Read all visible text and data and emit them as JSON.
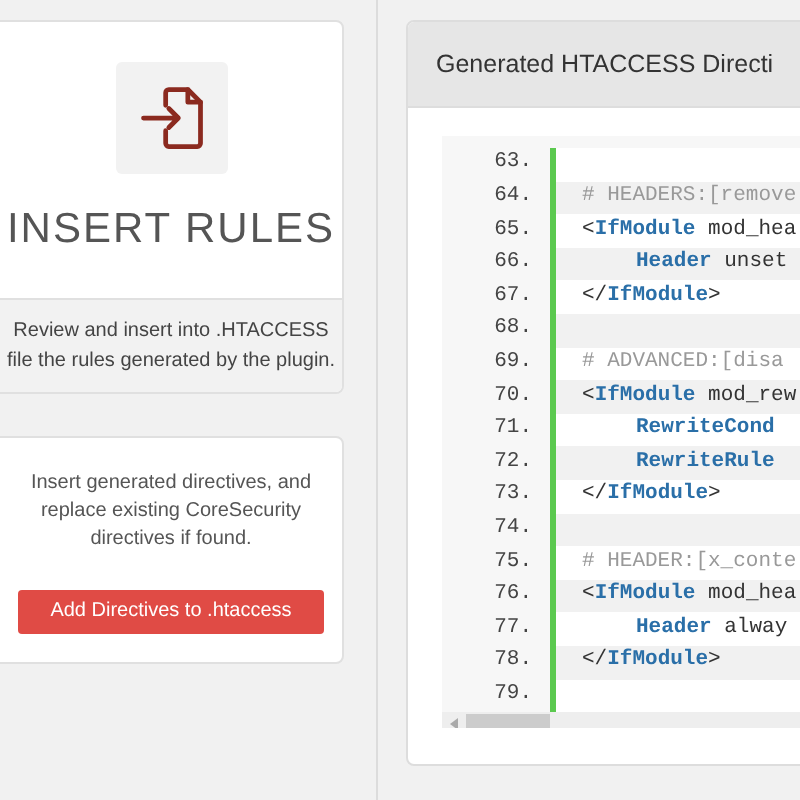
{
  "insert_card": {
    "title": "INSERT RULES",
    "description": "Review and insert into .HTACCESS file the rules generated by the plugin."
  },
  "action_card": {
    "text": "Insert generated directives, and replace existing CoreSecurity directives if found.",
    "button": "Add Directives to .htaccess"
  },
  "code_panel": {
    "title": "Generated HTACCESS Directi",
    "lines": [
      {
        "number": "63."
      },
      {
        "number": "64.",
        "indented": false,
        "tokens": [
          {
            "kind": "comment",
            "text": "# HEADERS:[remove"
          }
        ]
      },
      {
        "number": "65.",
        "indented": false,
        "tokens": [
          {
            "kind": "plain",
            "text": "<"
          },
          {
            "kind": "keyword",
            "text": "IfModule"
          },
          {
            "kind": "plain",
            "text": " mod_hea"
          }
        ]
      },
      {
        "number": "66.",
        "indented": true,
        "tokens": [
          {
            "kind": "keyword",
            "text": "Header"
          },
          {
            "kind": "plain",
            "text": " unset"
          }
        ]
      },
      {
        "number": "67.",
        "indented": false,
        "tokens": [
          {
            "kind": "plain",
            "text": "</"
          },
          {
            "kind": "keyword",
            "text": "IfModule"
          },
          {
            "kind": "plain",
            "text": ">"
          }
        ]
      },
      {
        "number": "68."
      },
      {
        "number": "69.",
        "indented": false,
        "tokens": [
          {
            "kind": "comment",
            "text": "# ADVANCED:[disa"
          }
        ]
      },
      {
        "number": "70.",
        "indented": false,
        "tokens": [
          {
            "kind": "plain",
            "text": "<"
          },
          {
            "kind": "keyword",
            "text": "IfModule"
          },
          {
            "kind": "plain",
            "text": " mod_rew"
          }
        ]
      },
      {
        "number": "71.",
        "indented": true,
        "tokens": [
          {
            "kind": "keyword",
            "text": "RewriteCond"
          }
        ]
      },
      {
        "number": "72.",
        "indented": true,
        "tokens": [
          {
            "kind": "keyword",
            "text": "RewriteRule"
          }
        ]
      },
      {
        "number": "73.",
        "indented": false,
        "tokens": [
          {
            "kind": "plain",
            "text": "</"
          },
          {
            "kind": "keyword",
            "text": "IfModule"
          },
          {
            "kind": "plain",
            "text": ">"
          }
        ]
      },
      {
        "number": "74."
      },
      {
        "number": "75.",
        "indented": false,
        "tokens": [
          {
            "kind": "comment",
            "text": "# HEADER:[x_conte"
          }
        ]
      },
      {
        "number": "76.",
        "indented": false,
        "tokens": [
          {
            "kind": "plain",
            "text": "<"
          },
          {
            "kind": "keyword",
            "text": "IfModule"
          },
          {
            "kind": "plain",
            "text": " mod_hea"
          }
        ]
      },
      {
        "number": "77.",
        "indented": true,
        "tokens": [
          {
            "kind": "keyword",
            "text": "Header"
          },
          {
            "kind": "plain",
            "text": " alway"
          }
        ]
      },
      {
        "number": "78.",
        "indented": false,
        "tokens": [
          {
            "kind": "plain",
            "text": "</"
          },
          {
            "kind": "keyword",
            "text": "IfModule"
          },
          {
            "kind": "plain",
            "text": ">"
          }
        ]
      },
      {
        "number": "79."
      }
    ]
  }
}
